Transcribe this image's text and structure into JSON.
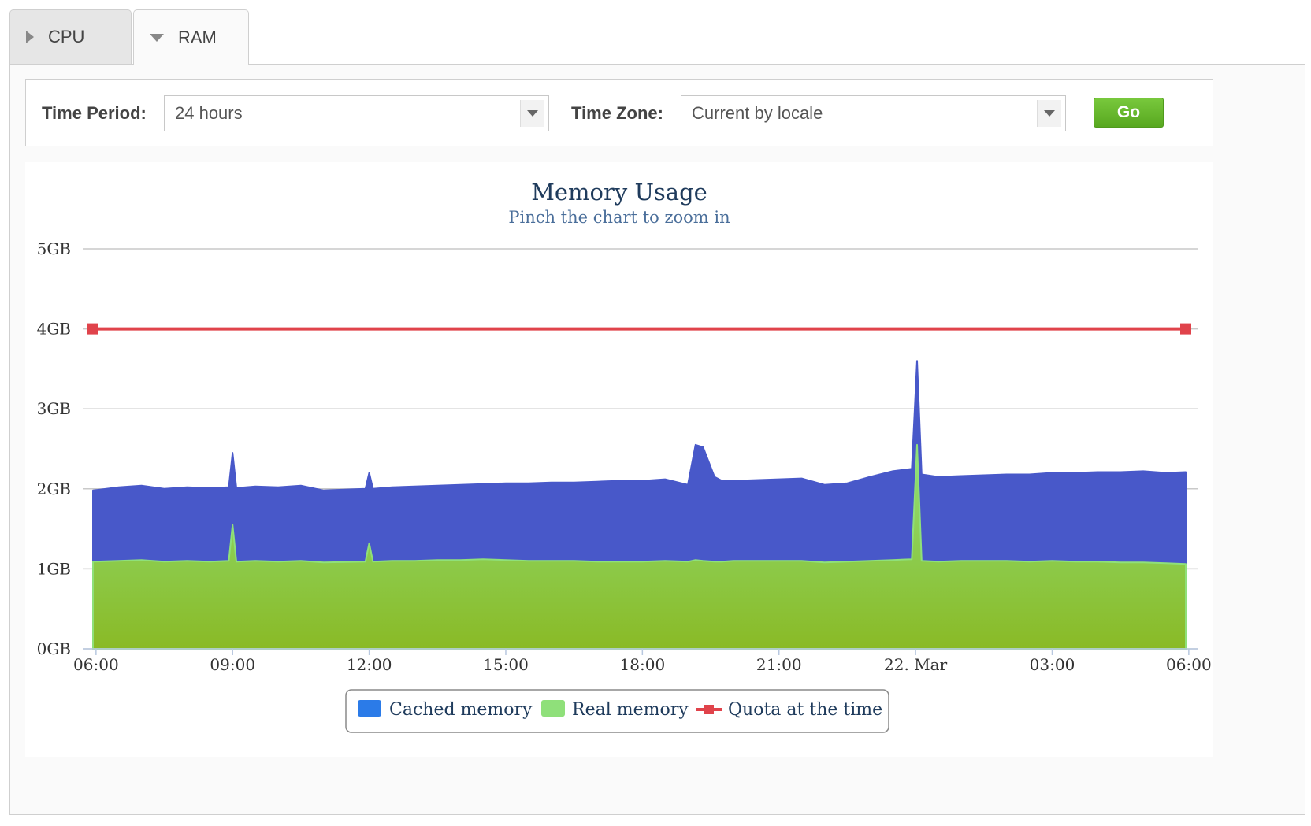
{
  "tabs": [
    {
      "label": "CPU",
      "expanded": false
    },
    {
      "label": "RAM",
      "expanded": true
    }
  ],
  "filters": {
    "time_period_label": "Time Period:",
    "time_period_value": "24 hours",
    "time_zone_label": "Time Zone:",
    "time_zone_value": "Current by locale",
    "go_label": "Go"
  },
  "colors": {
    "cached": "#4858c9",
    "real_top": "#8fe07a",
    "real_bottom": "#8aba26",
    "quota": "#e0434b",
    "legend_cached": "#2b7be8",
    "legend_real": "#8fe07a"
  },
  "chart_data": {
    "type": "area",
    "title": "Memory Usage",
    "subtitle": "Pinch the chart to zoom in",
    "y_unit": "GB",
    "ylim": [
      0,
      5
    ],
    "y_ticks": [
      "0GB",
      "1GB",
      "2GB",
      "3GB",
      "4GB",
      "5GB"
    ],
    "x_range": [
      "2024-03-21 05:56",
      "2024-03-22 05:56"
    ],
    "x_ticks": [
      {
        "time": "2024-03-21 06:00",
        "label": "06:00"
      },
      {
        "time": "2024-03-21 09:00",
        "label": "09:00"
      },
      {
        "time": "2024-03-21 12:00",
        "label": "12:00"
      },
      {
        "time": "2024-03-21 15:00",
        "label": "15:00"
      },
      {
        "time": "2024-03-21 18:00",
        "label": "18:00"
      },
      {
        "time": "2024-03-21 21:00",
        "label": "21:00"
      },
      {
        "time": "2024-03-22 00:00",
        "label": "22. Mar"
      },
      {
        "time": "2024-03-22 03:00",
        "label": "03:00"
      },
      {
        "time": "2024-03-22 06:00",
        "label": "06:00"
      }
    ],
    "grid": true,
    "legend_position": "bottom-center",
    "series": [
      {
        "name": "Cached memory",
        "type": "area",
        "x": [
          "2024-03-21 05:56",
          "2024-03-21 06:30",
          "2024-03-21 07:00",
          "2024-03-21 07:30",
          "2024-03-21 08:00",
          "2024-03-21 08:30",
          "2024-03-21 08:55",
          "2024-03-21 09:00",
          "2024-03-21 09:05",
          "2024-03-21 09:30",
          "2024-03-21 10:00",
          "2024-03-21 10:30",
          "2024-03-21 11:00",
          "2024-03-21 11:55",
          "2024-03-21 12:00",
          "2024-03-21 12:05",
          "2024-03-21 12:30",
          "2024-03-21 13:00",
          "2024-03-21 13:30",
          "2024-03-21 14:00",
          "2024-03-21 14:30",
          "2024-03-21 15:00",
          "2024-03-21 15:30",
          "2024-03-21 16:00",
          "2024-03-21 16:30",
          "2024-03-21 17:00",
          "2024-03-21 17:30",
          "2024-03-21 18:00",
          "2024-03-21 18:30",
          "2024-03-21 19:00",
          "2024-03-21 19:10",
          "2024-03-21 19:20",
          "2024-03-21 19:35",
          "2024-03-21 19:45",
          "2024-03-21 20:00",
          "2024-03-21 20:30",
          "2024-03-21 21:00",
          "2024-03-21 21:30",
          "2024-03-21 22:00",
          "2024-03-21 22:30",
          "2024-03-21 23:00",
          "2024-03-21 23:30",
          "2024-03-21 23:55",
          "2024-03-22 00:02",
          "2024-03-22 00:08",
          "2024-03-22 00:30",
          "2024-03-22 01:00",
          "2024-03-22 01:30",
          "2024-03-22 02:00",
          "2024-03-22 02:30",
          "2024-03-22 03:00",
          "2024-03-22 03:30",
          "2024-03-22 04:00",
          "2024-03-22 04:30",
          "2024-03-22 05:00",
          "2024-03-22 05:30",
          "2024-03-22 05:56"
        ],
        "values": [
          1.98,
          2.02,
          2.04,
          2.0,
          2.02,
          2.01,
          2.02,
          2.45,
          2.01,
          2.03,
          2.02,
          2.04,
          1.98,
          2.0,
          2.2,
          2.0,
          2.02,
          2.03,
          2.04,
          2.05,
          2.06,
          2.07,
          2.07,
          2.08,
          2.08,
          2.09,
          2.1,
          2.1,
          2.12,
          2.05,
          2.55,
          2.52,
          2.15,
          2.1,
          2.1,
          2.11,
          2.12,
          2.13,
          2.05,
          2.07,
          2.15,
          2.22,
          2.25,
          3.6,
          2.18,
          2.15,
          2.16,
          2.17,
          2.18,
          2.18,
          2.2,
          2.2,
          2.21,
          2.21,
          2.22,
          2.2,
          2.21
        ]
      },
      {
        "name": "Real memory",
        "type": "area",
        "x": [
          "2024-03-21 05:56",
          "2024-03-21 06:30",
          "2024-03-21 07:00",
          "2024-03-21 07:30",
          "2024-03-21 08:00",
          "2024-03-21 08:30",
          "2024-03-21 08:55",
          "2024-03-21 09:00",
          "2024-03-21 09:05",
          "2024-03-21 09:30",
          "2024-03-21 10:00",
          "2024-03-21 10:30",
          "2024-03-21 11:00",
          "2024-03-21 11:55",
          "2024-03-21 12:00",
          "2024-03-21 12:05",
          "2024-03-21 12:30",
          "2024-03-21 13:00",
          "2024-03-21 13:30",
          "2024-03-21 14:00",
          "2024-03-21 14:30",
          "2024-03-21 15:00",
          "2024-03-21 15:30",
          "2024-03-21 16:00",
          "2024-03-21 16:30",
          "2024-03-21 17:00",
          "2024-03-21 17:30",
          "2024-03-21 18:00",
          "2024-03-21 18:30",
          "2024-03-21 19:00",
          "2024-03-21 19:10",
          "2024-03-21 19:20",
          "2024-03-21 19:35",
          "2024-03-21 19:45",
          "2024-03-21 20:00",
          "2024-03-21 20:30",
          "2024-03-21 21:00",
          "2024-03-21 21:30",
          "2024-03-21 22:00",
          "2024-03-21 22:30",
          "2024-03-21 23:00",
          "2024-03-21 23:30",
          "2024-03-21 23:55",
          "2024-03-22 00:02",
          "2024-03-22 00:08",
          "2024-03-22 00:30",
          "2024-03-22 01:00",
          "2024-03-22 01:30",
          "2024-03-22 02:00",
          "2024-03-22 02:30",
          "2024-03-22 03:00",
          "2024-03-22 03:30",
          "2024-03-22 04:00",
          "2024-03-22 04:30",
          "2024-03-22 05:00",
          "2024-03-22 05:30",
          "2024-03-22 05:56"
        ],
        "values": [
          1.09,
          1.1,
          1.11,
          1.09,
          1.1,
          1.09,
          1.1,
          1.55,
          1.09,
          1.1,
          1.09,
          1.1,
          1.08,
          1.09,
          1.32,
          1.09,
          1.1,
          1.1,
          1.11,
          1.11,
          1.12,
          1.11,
          1.1,
          1.1,
          1.1,
          1.09,
          1.09,
          1.09,
          1.1,
          1.09,
          1.11,
          1.1,
          1.09,
          1.09,
          1.1,
          1.1,
          1.1,
          1.1,
          1.08,
          1.09,
          1.1,
          1.11,
          1.12,
          2.55,
          1.1,
          1.09,
          1.1,
          1.1,
          1.1,
          1.09,
          1.1,
          1.09,
          1.09,
          1.08,
          1.08,
          1.07,
          1.06
        ]
      },
      {
        "name": "Quota at the time",
        "type": "line",
        "x": [
          "2024-03-21 05:56",
          "2024-03-22 05:56"
        ],
        "values": [
          4,
          4
        ]
      }
    ]
  }
}
